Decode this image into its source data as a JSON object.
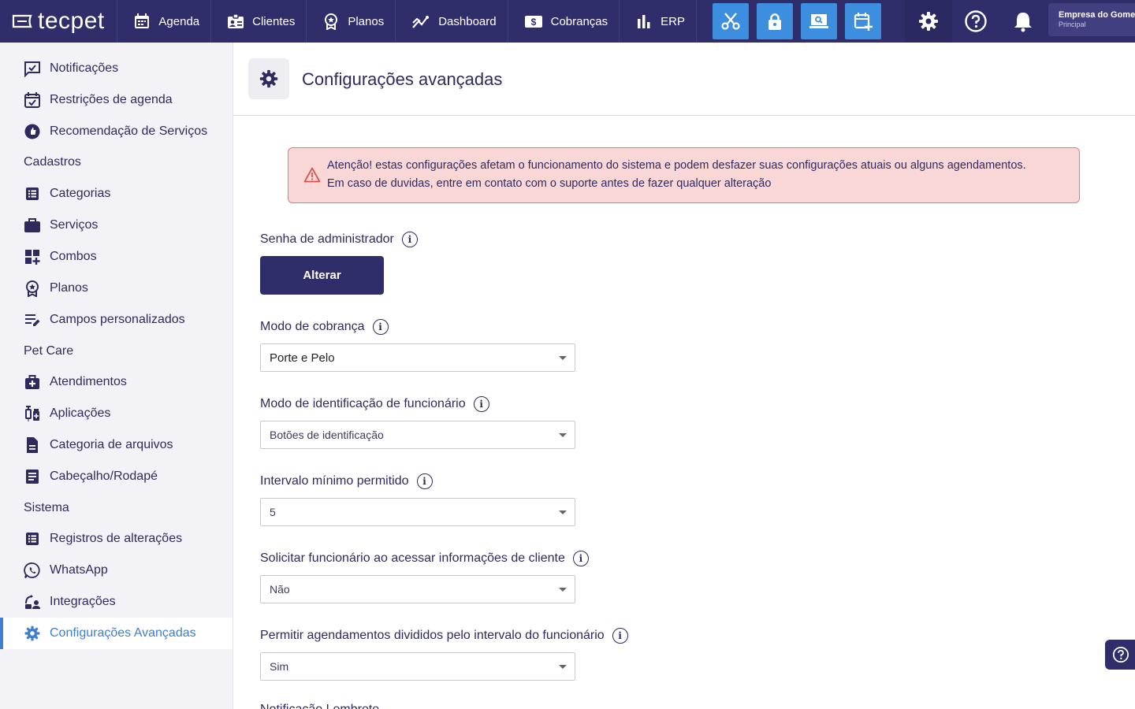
{
  "brand": {
    "logo_text": "tecpet"
  },
  "nav": {
    "items": [
      {
        "label": "Agenda",
        "icon": "calendar-icon"
      },
      {
        "label": "Clientes",
        "icon": "id-card-icon"
      },
      {
        "label": "Planos",
        "icon": "badge-icon"
      },
      {
        "label": "Dashboard",
        "icon": "chart-line-icon"
      },
      {
        "label": "Cobranças",
        "icon": "money-icon"
      },
      {
        "label": "ERP",
        "icon": "bar-chart-icon"
      }
    ],
    "quick_actions": [
      "scissors-icon",
      "lock-icon",
      "screen-search-icon",
      "calendar-add-icon"
    ],
    "right_icons": [
      "gear-icon",
      "help-circle-icon",
      "bell-icon"
    ],
    "company": {
      "name": "Empresa do Gome",
      "unit": "Principal"
    }
  },
  "sidebar": {
    "items_top": [
      {
        "label": "Notificações",
        "icon": "chat-check-icon"
      },
      {
        "label": "Restrições de agenda",
        "icon": "calendar-check-icon"
      },
      {
        "label": "Recomendação de Serviços",
        "icon": "recommend-icon"
      }
    ],
    "section_cadastros": "Cadastros",
    "items_cadastros": [
      {
        "label": "Categorias",
        "icon": "list-icon"
      },
      {
        "label": "Serviços",
        "icon": "briefcase-icon"
      },
      {
        "label": "Combos",
        "icon": "grid-plus-icon"
      },
      {
        "label": "Planos",
        "icon": "badge-icon"
      },
      {
        "label": "Campos personalizados",
        "icon": "edit-list-icon"
      }
    ],
    "section_petcare": "Pet Care",
    "items_petcare": [
      {
        "label": "Atendimentos",
        "icon": "medical-bag-icon"
      },
      {
        "label": "Aplicações",
        "icon": "syringe-icon"
      },
      {
        "label": "Categoria de arquivos",
        "icon": "file-icon"
      },
      {
        "label": "Cabeçalho/Rodapé",
        "icon": "document-icon"
      }
    ],
    "section_sistema": "Sistema",
    "items_sistema": [
      {
        "label": "Registros de alterações",
        "icon": "list-icon"
      },
      {
        "label": "WhatsApp",
        "icon": "whatsapp-icon"
      },
      {
        "label": "Integrações",
        "icon": "integration-icon"
      },
      {
        "label": "Configurações Avançadas",
        "icon": "gear-icon",
        "active": true
      }
    ]
  },
  "page": {
    "title": "Configurações avançadas",
    "alert": {
      "line1": "Atenção! estas configurações afetam o funcionamento do sistema e podem desfazer suas configurações atuais ou alguns agendamentos.",
      "line2": "Em caso de duvidas, entre em contato com o suporte antes de fazer qualquer alteração"
    },
    "admin_password": {
      "label": "Senha de administrador",
      "button": "Alterar"
    },
    "fields": [
      {
        "label": "Modo de cobrança",
        "value": "Porte e Pelo"
      },
      {
        "label": "Modo de identificação de funcionário",
        "value": "Botões de identificação"
      },
      {
        "label": "Intervalo mínimo permitido",
        "value": "5"
      },
      {
        "label": "Solicitar funcionário ao acessar informações de cliente",
        "value": "Não"
      },
      {
        "label": "Permitir agendamentos divididos pelo intervalo do funcionário",
        "value": "Sim"
      }
    ],
    "partial_label": "Notificação Lembrete"
  },
  "colors": {
    "nav_bg": "#2f2e6b",
    "accent_blue": "#3e8ee0",
    "active_link": "#3e7fcf",
    "alert_bg": "#f9d7d7",
    "alert_border": "#e07c7c"
  }
}
